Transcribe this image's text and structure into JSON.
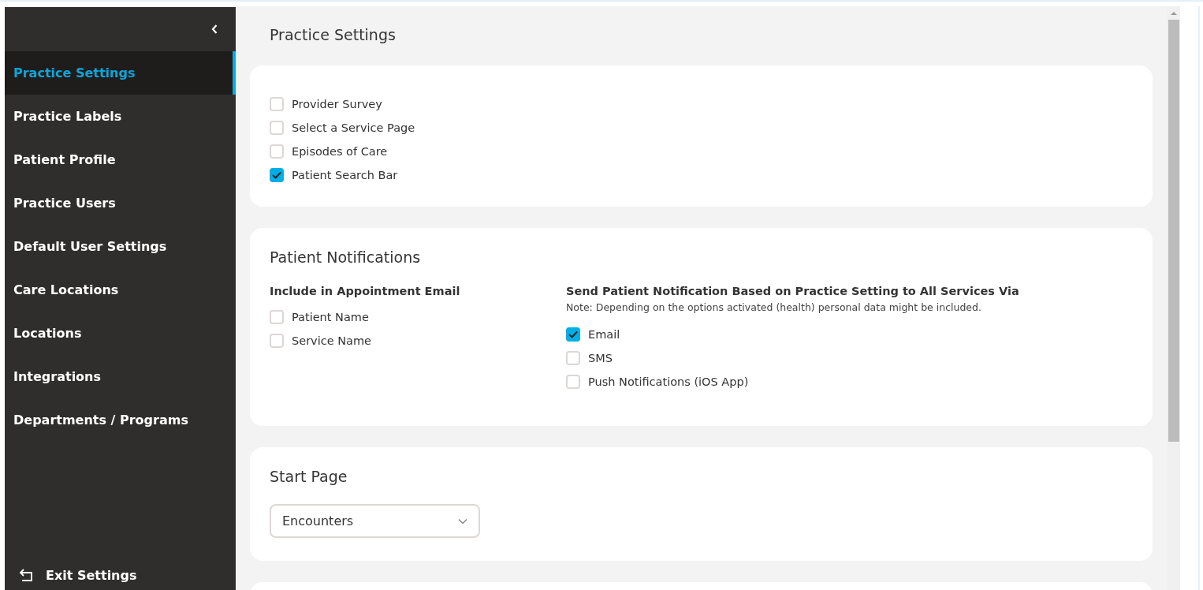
{
  "sidebar": {
    "items": [
      {
        "label": "Practice Settings",
        "selected": true
      },
      {
        "label": "Practice Labels",
        "selected": false
      },
      {
        "label": "Patient Profile",
        "selected": false
      },
      {
        "label": "Practice Users",
        "selected": false
      },
      {
        "label": "Default User Settings",
        "selected": false
      },
      {
        "label": "Care Locations",
        "selected": false
      },
      {
        "label": "Locations",
        "selected": false
      },
      {
        "label": "Integrations",
        "selected": false
      },
      {
        "label": "Departments / Programs",
        "selected": false
      }
    ],
    "exit": "Exit Settings"
  },
  "page_title": "Practice Settings",
  "features": [
    {
      "label": "Provider Survey",
      "checked": false
    },
    {
      "label": "Select a Service Page",
      "checked": false
    },
    {
      "label": "Episodes of Care",
      "checked": false
    },
    {
      "label": "Patient Search Bar",
      "checked": true
    }
  ],
  "notifications": {
    "title": "Patient Notifications",
    "email_content": {
      "heading": "Include in Appointment Email",
      "options": [
        {
          "label": "Patient Name",
          "checked": false
        },
        {
          "label": "Service Name",
          "checked": false
        }
      ]
    },
    "channels": {
      "heading": "Send Patient Notification Based on Practice Setting to All Services Via",
      "note": "Note: Depending on the options activated (health) personal data might be included.",
      "options": [
        {
          "label": "Email",
          "checked": true
        },
        {
          "label": "SMS",
          "checked": false
        },
        {
          "label": "Push Notifications (iOS App)",
          "checked": false
        }
      ]
    }
  },
  "start_page": {
    "title": "Start Page",
    "value": "Encounters"
  }
}
